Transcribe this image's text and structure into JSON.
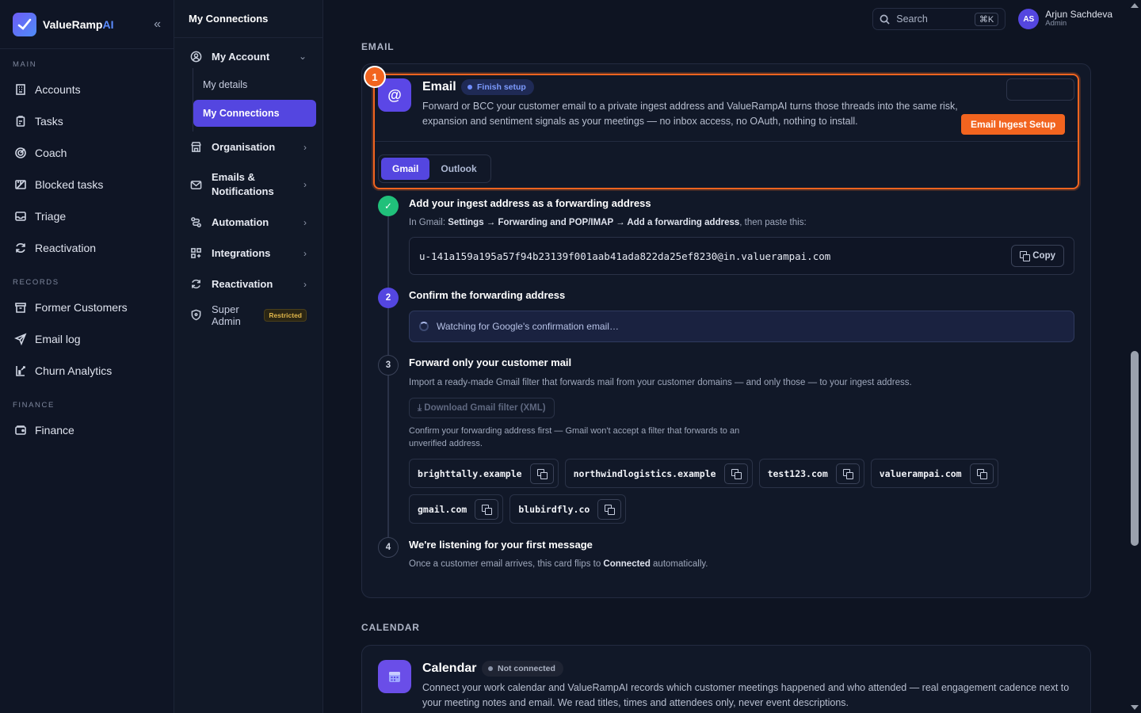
{
  "brand": {
    "name_main": "ValueRamp",
    "name_ai": "AI"
  },
  "sidebar": {
    "sections": [
      {
        "label": "MAIN",
        "items": [
          {
            "label": "Accounts",
            "icon": "building-icon"
          },
          {
            "label": "Tasks",
            "icon": "clipboard-icon"
          },
          {
            "label": "Coach",
            "icon": "target-icon"
          },
          {
            "label": "Blocked tasks",
            "icon": "blocked-icon"
          },
          {
            "label": "Triage",
            "icon": "inbox-icon"
          },
          {
            "label": "Reactivation",
            "icon": "refresh-icon"
          }
        ]
      },
      {
        "label": "RECORDS",
        "items": [
          {
            "label": "Former Customers",
            "icon": "archive-icon"
          },
          {
            "label": "Email log",
            "icon": "send-icon"
          },
          {
            "label": "Churn Analytics",
            "icon": "chart-icon"
          }
        ]
      },
      {
        "label": "FINANCE",
        "items": [
          {
            "label": "Finance",
            "icon": "wallet-icon"
          }
        ]
      }
    ]
  },
  "settings_nav": {
    "header": "My Connections",
    "my_account": "My Account",
    "my_details": "My details",
    "my_connections": "My Connections",
    "organisation": "Organisation",
    "emails_line1": "Emails &",
    "emails_line2": "Notifications",
    "automation": "Automation",
    "integrations": "Integrations",
    "reactivation": "Reactivation",
    "super_admin": "Super Admin",
    "restricted": "Restricted"
  },
  "topbar": {
    "search_placeholder": "Search",
    "shortcut": "⌘K",
    "user_initials": "AS",
    "user_name": "Arjun Sachdeva",
    "user_role": "Admin"
  },
  "email_section": {
    "label": "EMAIL",
    "title": "Email",
    "icon_glyph": "@",
    "status": "Finish setup",
    "description": "Forward or BCC your customer email to a private ingest address and ValueRampAI turns those threads into the same risk, expansion and sentiment signals as your meetings — no inbox access, no OAuth, nothing to install.",
    "callout_number": "1",
    "callout_label": "Email Ingest Setup",
    "tabs": [
      "Gmail",
      "Outlook"
    ],
    "step1": {
      "title": "Add your ingest address as a forwarding address",
      "text_pre": "In Gmail: ",
      "text_path": "Settings → Forwarding and POP/IMAP → Add a forwarding address",
      "text_post": ", then paste this:",
      "address": "u-141a159a195a57f94b23139f001aab41ada822da25ef8230@in.valuerampai.com",
      "copy_label": "Copy"
    },
    "step2": {
      "number": "2",
      "title": "Confirm the forwarding address",
      "status": "Watching for Google's confirmation email…"
    },
    "step3": {
      "number": "3",
      "title": "Forward only your customer mail",
      "text": "Import a ready-made Gmail filter that forwards mail from your customer domains — and only those — to your ingest address.",
      "download_label": "⤓ Download Gmail filter (XML)",
      "note_line1": "Confirm your forwarding address first — Gmail won't accept a filter that forwards to an",
      "note_line2": "unverified address.",
      "domains": [
        "brighttally.example",
        "northwindlogistics.example",
        "test123.com",
        "valuerampai.com",
        "gmail.com",
        "blubirdfly.co"
      ]
    },
    "step4": {
      "number": "4",
      "title": "We're listening for your first message",
      "text_pre": "Once a customer email arrives, this card flips to ",
      "text_bold": "Connected",
      "text_post": " automatically."
    }
  },
  "calendar_section": {
    "label": "CALENDAR",
    "title": "Calendar",
    "status": "Not connected",
    "description": "Connect your work calendar and ValueRampAI records which customer meetings happened and who attended — real engagement cadence next to your meeting notes and email. We read titles, times and attendees only, never event descriptions."
  },
  "colors": {
    "accent": "#5446e0",
    "highlight": "#f2641f",
    "success": "#20c07a"
  }
}
